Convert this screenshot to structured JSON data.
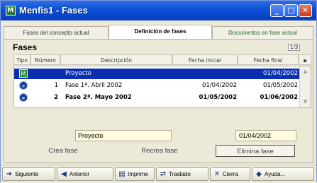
{
  "window": {
    "title": "Menfis1 - Fases",
    "minimize": "_",
    "maximize": "□",
    "close": "✕"
  },
  "tabs": [
    {
      "label": "Fases del concepto actual"
    },
    {
      "label": "Definición de fases"
    },
    {
      "label": "Documentos en fase actual"
    }
  ],
  "section": {
    "title": "Fases",
    "pager": "1/3"
  },
  "grid": {
    "columns": [
      "Tipo",
      "Número",
      "Descripción",
      "Fecha inicial",
      "Fecha final"
    ],
    "rows": [
      {
        "number": "",
        "description": "Proyecto",
        "start": "",
        "end": "01/04/2002"
      },
      {
        "number": "1",
        "description": "Fase 1ª. Abril 2002",
        "start": "01/04/2002",
        "end": "01/05/2002"
      },
      {
        "number": "2",
        "description": "Fase 2ª. Mayo 2002",
        "start": "01/05/2002",
        "end": "01/06/2002"
      }
    ]
  },
  "edit": {
    "description": "Proyecto",
    "date": "01/04/2002"
  },
  "actions": {
    "create": "Crea fase",
    "recreate": "Recrea fase",
    "delete": "Elimina fase"
  },
  "toolbar": {
    "next": "Siguiente",
    "previous": "Anterior",
    "print": "Imprime",
    "transfer": "Traslado",
    "close": "Cierra",
    "help": "Ayuda..."
  }
}
